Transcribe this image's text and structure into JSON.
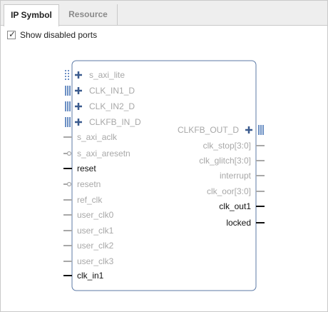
{
  "tabs": [
    {
      "label": "IP Symbol",
      "active": true
    },
    {
      "label": "Resource",
      "active": false
    }
  ],
  "options": {
    "show_disabled_ports": {
      "label": "Show disabled ports",
      "checked": true
    }
  },
  "symbol": {
    "left_ports": [
      {
        "name": "s_axi_lite",
        "kind": "bus",
        "enabled": false
      },
      {
        "name": "CLK_IN1_D",
        "kind": "bus",
        "enabled": false
      },
      {
        "name": "CLK_IN2_D",
        "kind": "bus",
        "enabled": false
      },
      {
        "name": "CLKFB_IN_D",
        "kind": "bus",
        "enabled": false
      },
      {
        "name": "s_axi_aclk",
        "kind": "wire",
        "enabled": false
      },
      {
        "name": "s_axi_aresetn",
        "kind": "wire-inverted",
        "enabled": false
      },
      {
        "name": "reset",
        "kind": "wire",
        "enabled": true
      },
      {
        "name": "resetn",
        "kind": "wire-inverted",
        "enabled": false
      },
      {
        "name": "ref_clk",
        "kind": "wire",
        "enabled": false
      },
      {
        "name": "user_clk0",
        "kind": "wire",
        "enabled": false
      },
      {
        "name": "user_clk1",
        "kind": "wire",
        "enabled": false
      },
      {
        "name": "user_clk2",
        "kind": "wire",
        "enabled": false
      },
      {
        "name": "user_clk3",
        "kind": "wire",
        "enabled": false
      },
      {
        "name": "clk_in1",
        "kind": "wire",
        "enabled": true
      }
    ],
    "right_ports": [
      {
        "name": "CLKFB_OUT_D",
        "kind": "bus",
        "enabled": false
      },
      {
        "name": "clk_stop[3:0]",
        "kind": "wire",
        "enabled": false
      },
      {
        "name": "clk_glitch[3:0]",
        "kind": "wire",
        "enabled": false
      },
      {
        "name": "interrupt",
        "kind": "wire",
        "enabled": false
      },
      {
        "name": "clk_oor[3:0]",
        "kind": "wire",
        "enabled": false
      },
      {
        "name": "clk_out1",
        "kind": "wire",
        "enabled": true
      },
      {
        "name": "locked",
        "kind": "wire",
        "enabled": true
      }
    ]
  }
}
